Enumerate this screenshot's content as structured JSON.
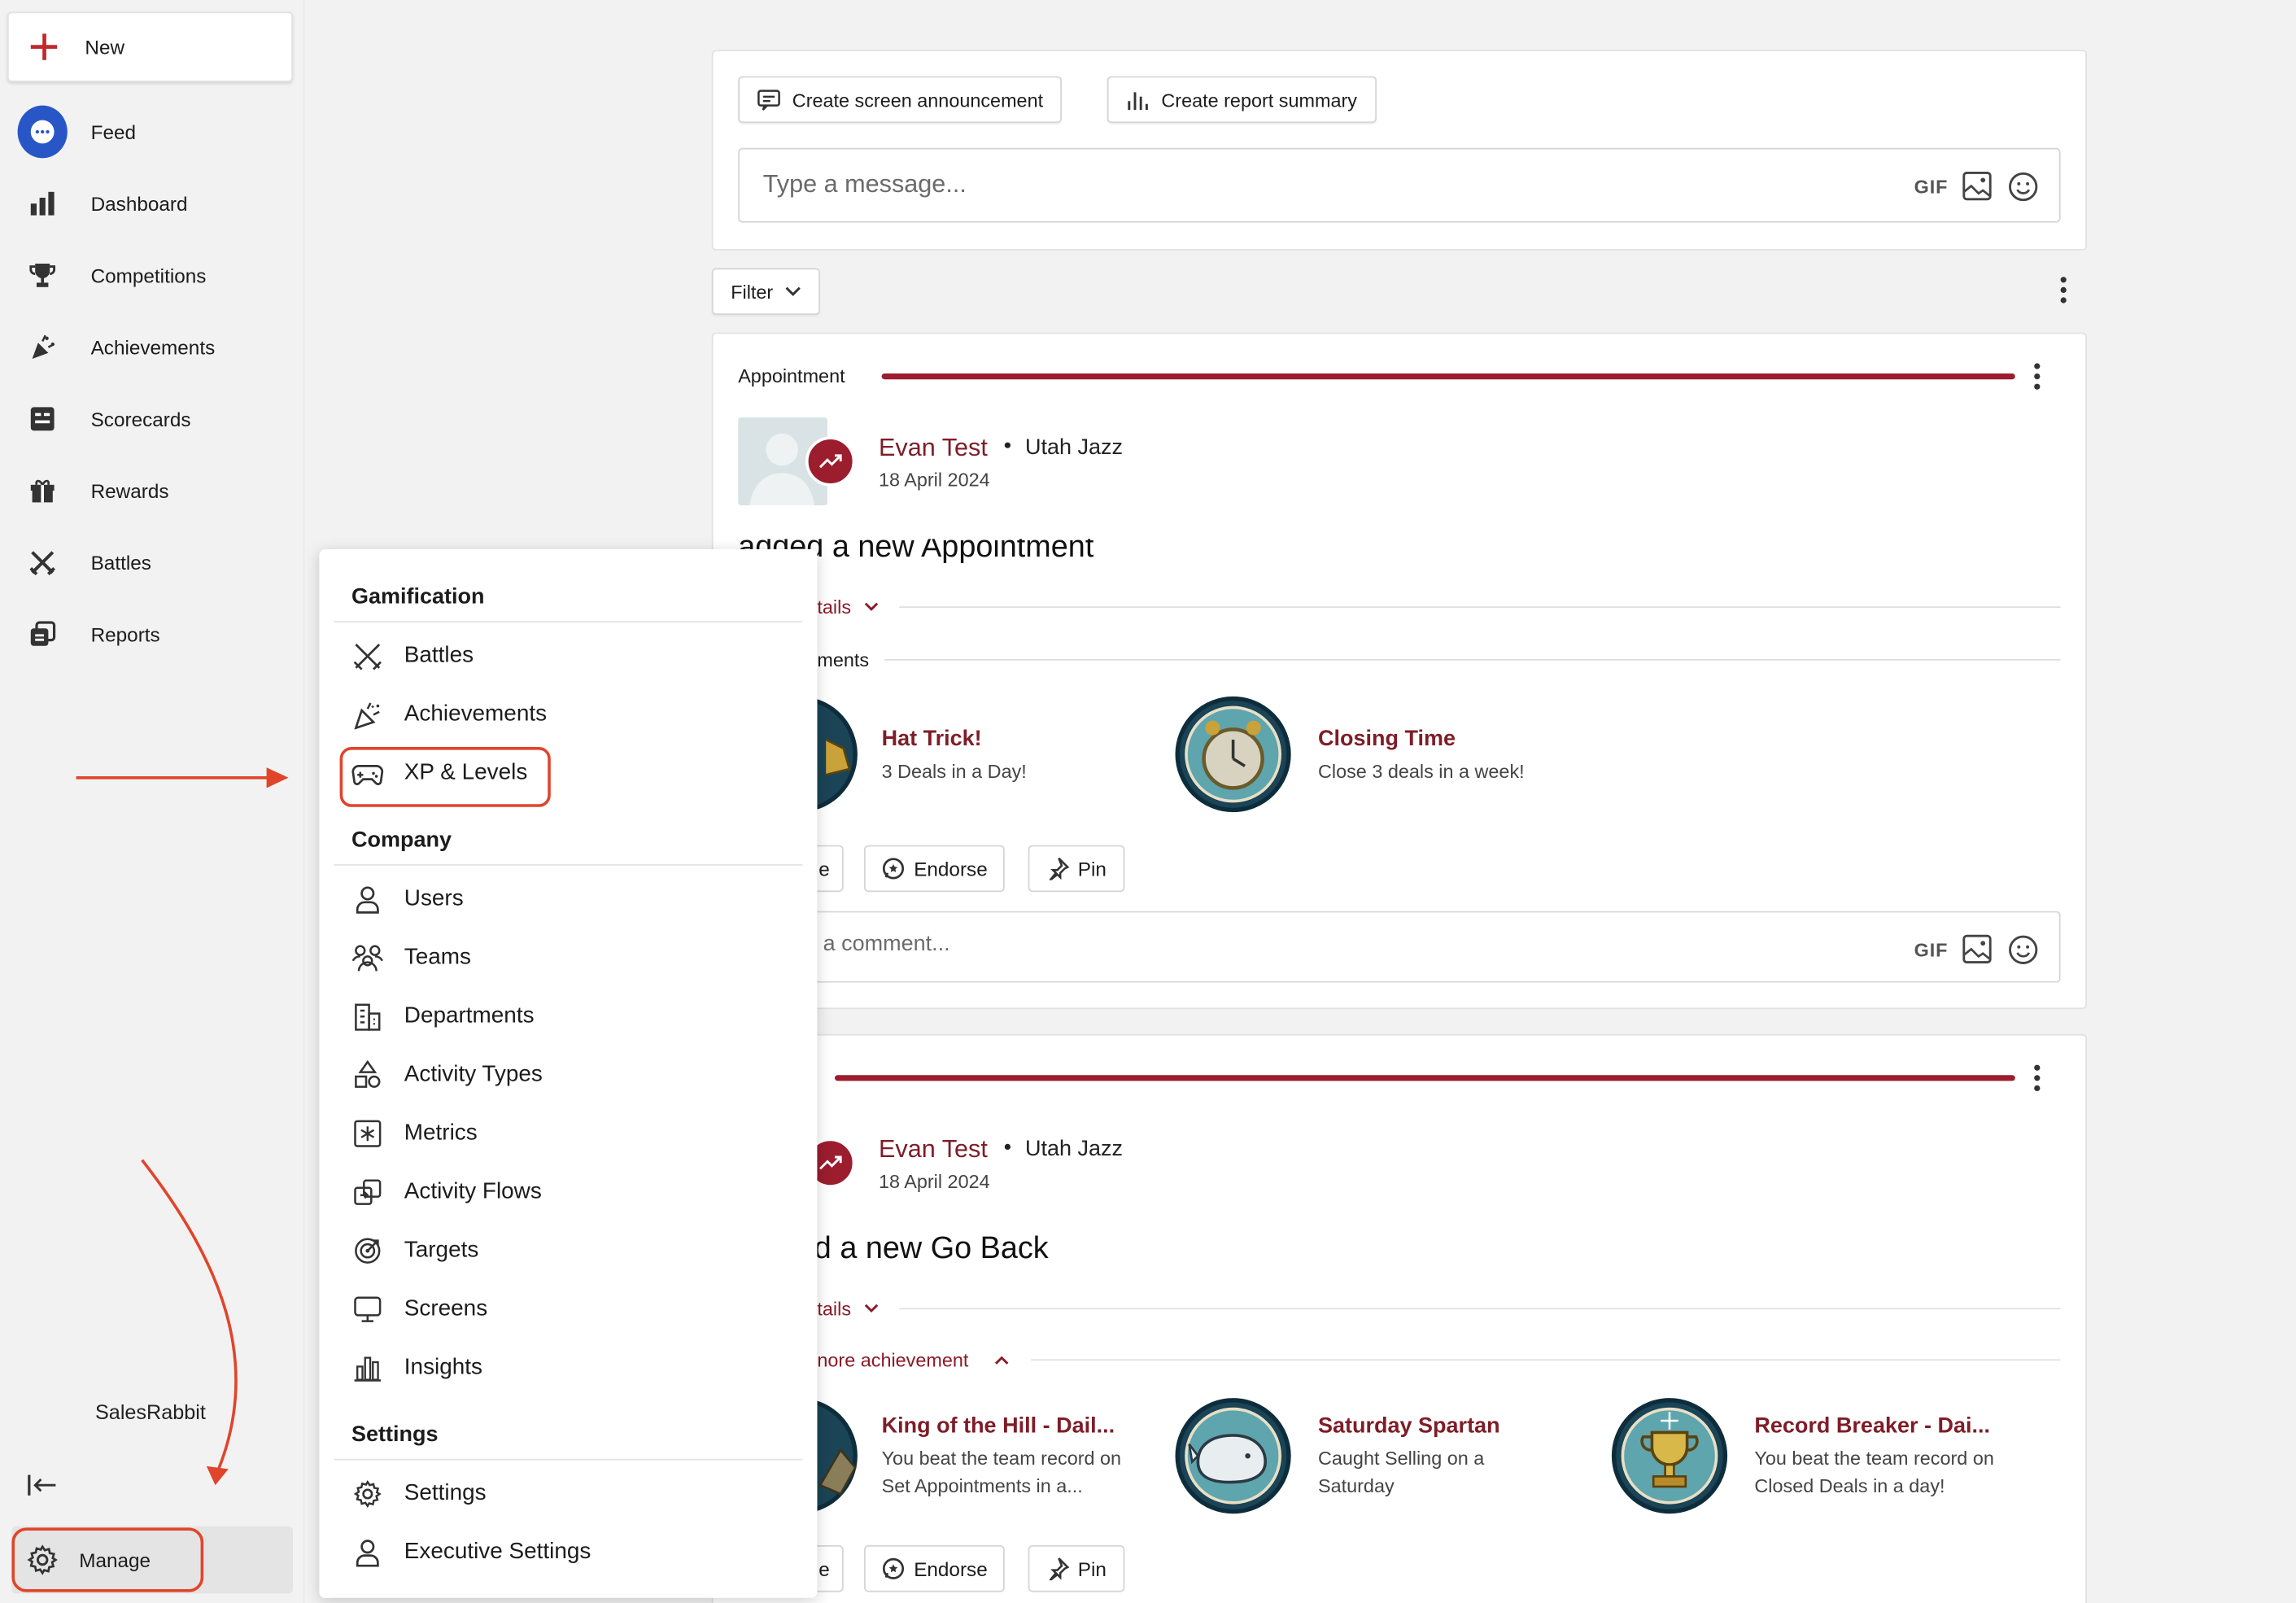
{
  "sidebar": {
    "new_label": "New",
    "items": [
      {
        "label": "Feed",
        "icon": "feed-icon"
      },
      {
        "label": "Dashboard",
        "icon": "bar-chart-icon"
      },
      {
        "label": "Competitions",
        "icon": "trophy-icon"
      },
      {
        "label": "Achievements",
        "icon": "party-popper-icon"
      },
      {
        "label": "Scorecards",
        "icon": "scorecard-icon"
      },
      {
        "label": "Rewards",
        "icon": "gift-icon"
      },
      {
        "label": "Battles",
        "icon": "crossed-swords-icon"
      },
      {
        "label": "Reports",
        "icon": "reports-icon"
      }
    ],
    "brand": "SalesRabbit",
    "manage_label": "Manage"
  },
  "menu": {
    "sections": [
      {
        "title": "Gamification",
        "items": [
          "Battles",
          "Achievements",
          "XP & Levels"
        ]
      },
      {
        "title": "Company",
        "items": [
          "Users",
          "Teams",
          "Departments",
          "Activity Types",
          "Metrics",
          "Activity Flows",
          "Targets",
          "Screens",
          "Insights"
        ]
      },
      {
        "title": "Settings",
        "items": [
          "Settings",
          "Executive Settings"
        ]
      }
    ]
  },
  "composer": {
    "announce_label": "Create screen announcement",
    "summary_label": "Create report summary",
    "placeholder": "Type a message...",
    "gif": "GIF"
  },
  "filter_label": "Filter",
  "posts": [
    {
      "type_label": "Appointment",
      "author": "Evan Test",
      "team": "Utah Jazz",
      "date": "18 April 2024",
      "headline": "added a new Appointment",
      "details_label": "tails",
      "ach_section_label": "ments",
      "achievements": [
        {
          "title": "Hat Trick!",
          "desc": "3 Deals in a Day!"
        },
        {
          "title": "Closing Time",
          "desc": "Close 3 deals in a week!"
        }
      ],
      "actions": [
        "e",
        "Endorse",
        "Pin"
      ],
      "comment_placeholder": "a comment...",
      "gif": "GIF"
    },
    {
      "type_label": "",
      "author": "Evan Test",
      "team": "Utah Jazz",
      "date": "18 April 2024",
      "headline": "d a new Go Back",
      "details_label": "tails",
      "ach_section_label": "nore achievement",
      "achievements": [
        {
          "title": "King of the Hill - Dail...",
          "desc": "You beat the team record on Set Appointments in a..."
        },
        {
          "title": "Saturday Spartan",
          "desc": "Caught Selling on a Saturday"
        },
        {
          "title": "Record Breaker - Dai...",
          "desc": "You beat the team record on Closed Deals in a day!"
        }
      ],
      "actions": [
        "e",
        "Endorse",
        "Pin"
      ]
    }
  ],
  "colors": {
    "accent": "#9b1d2e",
    "annotation": "#e0452b",
    "feed_blue": "#2956c7"
  }
}
